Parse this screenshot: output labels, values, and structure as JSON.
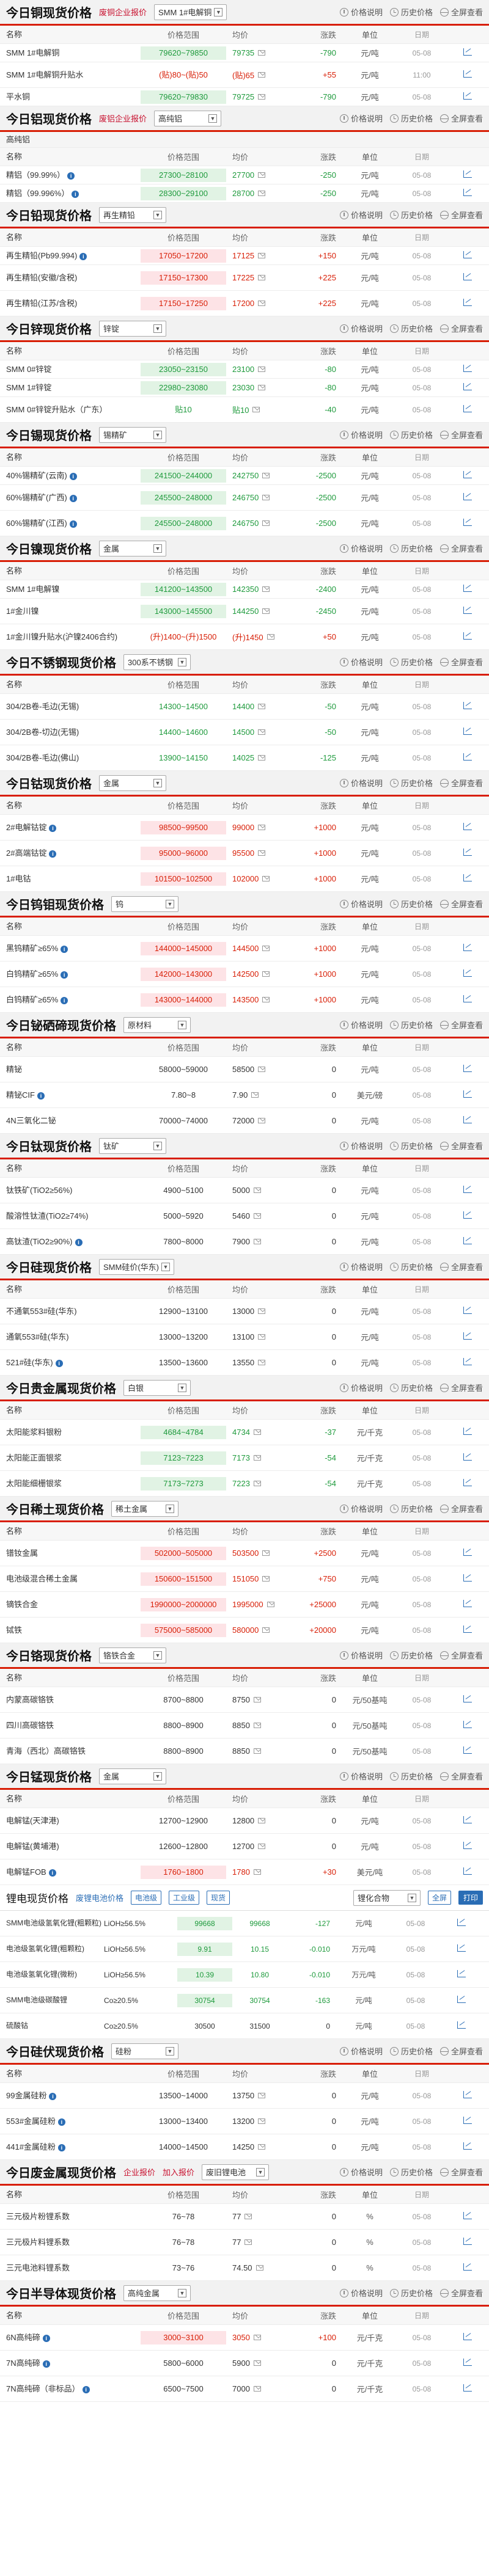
{
  "actions": {
    "desc": "价格说明",
    "hist": "历史价格",
    "all": "全屏查看"
  },
  "labels": {
    "corp_price": "废铝企业报价",
    "corp_price2": "企业报价",
    "add_alert": "加入报价"
  },
  "header": {
    "name": "名称",
    "range": "价格范围",
    "avg": "均价",
    "chg": "涨跌",
    "unit": "单位",
    "date": "日期"
  },
  "sections": [
    {
      "title": "今日铜现货价格",
      "link": "废铜企业报价",
      "sel": "SMM 1#电解铜",
      "rows": [
        {
          "name": "SMM 1#电解铜",
          "range": "79620~79850",
          "avg": "79735",
          "chg": "-790",
          "unit": "元/吨",
          "date": "05-08",
          "dir": "dn",
          "bg": "green"
        },
        {
          "name": "SMM 1#电解铜升贴水",
          "range": "(贴)80~(贴)50",
          "avg": "(贴)65",
          "chg": "+55",
          "unit": "元/吨",
          "date": "11:00",
          "dir": "up",
          "tall": true
        },
        {
          "name": "平水铜",
          "range": "79620~79830",
          "avg": "79725",
          "chg": "-790",
          "unit": "元/吨",
          "date": "05-08",
          "dir": "dn",
          "bg": "green"
        }
      ]
    },
    {
      "title": "今日铝现货价格",
      "link": "废铝企业报价",
      "sel": "高纯铝",
      "sub": "高纯铝",
      "rows": [
        {
          "name": "精铝（99.99%）",
          "range": "27300~28100",
          "avg": "27700",
          "chg": "-250",
          "unit": "元/吨",
          "date": "05-08",
          "dir": "dn",
          "bg": "green",
          "info": true
        },
        {
          "name": "精铝（99.996%）",
          "range": "28300~29100",
          "avg": "28700",
          "chg": "-250",
          "unit": "元/吨",
          "date": "05-08",
          "dir": "dn",
          "bg": "green",
          "info": true
        }
      ]
    },
    {
      "title": "今日铅现货价格",
      "link": "",
      "sel": "再生精铅",
      "rows": [
        {
          "name": "再生精铅(Pb99.994)",
          "range": "17050~17200",
          "avg": "17125",
          "chg": "+150",
          "unit": "元/吨",
          "date": "05-08",
          "dir": "up",
          "bg": "pink",
          "info": true
        },
        {
          "name": "再生精铅(安徽/含税)",
          "range": "17150~17300",
          "avg": "17225",
          "chg": "+225",
          "unit": "元/吨",
          "date": "05-08",
          "dir": "up",
          "bg": "pink",
          "tall": true
        },
        {
          "name": "再生精铅(江苏/含税)",
          "range": "17150~17250",
          "avg": "17200",
          "chg": "+225",
          "unit": "元/吨",
          "date": "05-08",
          "dir": "up",
          "bg": "pink",
          "tall": true
        }
      ]
    },
    {
      "title": "今日锌现货价格",
      "link": "",
      "sel": "锌锭",
      "rows": [
        {
          "name": "SMM 0#锌锭",
          "range": "23050~23150",
          "avg": "23100",
          "chg": "-80",
          "unit": "元/吨",
          "date": "05-08",
          "dir": "dn",
          "bg": "green"
        },
        {
          "name": "SMM 1#锌锭",
          "range": "22980~23080",
          "avg": "23030",
          "chg": "-80",
          "unit": "元/吨",
          "date": "05-08",
          "dir": "dn",
          "bg": "green"
        },
        {
          "name": "SMM 0#锌锭升贴水（广东）",
          "range": "贴10",
          "avg": "贴10",
          "chg": "-40",
          "unit": "元/吨",
          "date": "05-08",
          "dir": "dn",
          "tall": true
        }
      ]
    },
    {
      "title": "今日锡现货价格",
      "link": "",
      "sel": "锡精矿",
      "rows": [
        {
          "name": "40%锡精矿(云南)",
          "range": "241500~244000",
          "avg": "242750",
          "chg": "-2500",
          "unit": "元/吨",
          "date": "05-08",
          "dir": "dn",
          "bg": "green",
          "info": true
        },
        {
          "name": "60%锡精矿(广西)",
          "range": "245500~248000",
          "avg": "246750",
          "chg": "-2500",
          "unit": "元/吨",
          "date": "05-08",
          "dir": "dn",
          "bg": "green",
          "info": true,
          "tall": true
        },
        {
          "name": "60%锡精矿(江西)",
          "range": "245500~248000",
          "avg": "246750",
          "chg": "-2500",
          "unit": "元/吨",
          "date": "05-08",
          "dir": "dn",
          "bg": "green",
          "info": true,
          "tall": true
        }
      ]
    },
    {
      "title": "今日镍现货价格",
      "link": "",
      "sel": "金属",
      "rows": [
        {
          "name": "SMM 1#电解镍",
          "range": "141200~143500",
          "avg": "142350",
          "chg": "-2400",
          "unit": "元/吨",
          "date": "05-08",
          "dir": "dn",
          "bg": "green"
        },
        {
          "name": "1#金川镍",
          "range": "143000~145500",
          "avg": "144250",
          "chg": "-2450",
          "unit": "元/吨",
          "date": "05-08",
          "dir": "dn",
          "bg": "green",
          "tall": true
        },
        {
          "name": "1#金川镍升贴水(沪镍2406合约)",
          "range": "(升)1400~(升)1500",
          "avg": "(升)1450",
          "chg": "+50",
          "unit": "元/吨",
          "date": "05-08",
          "dir": "up",
          "tall": true
        }
      ]
    },
    {
      "title": "今日不锈钢现货价格",
      "link": "",
      "sel": "300系不锈钢",
      "rows": [
        {
          "name": "304/2B卷-毛边(无锡)",
          "range": "14300~14500",
          "avg": "14400",
          "chg": "-50",
          "unit": "元/吨",
          "date": "05-08",
          "dir": "dn",
          "tall": true
        },
        {
          "name": "304/2B卷-切边(无锡)",
          "range": "14400~14600",
          "avg": "14500",
          "chg": "-50",
          "unit": "元/吨",
          "date": "05-08",
          "dir": "dn",
          "tall": true
        },
        {
          "name": "304/2B卷-毛边(佛山)",
          "range": "13900~14150",
          "avg": "14025",
          "chg": "-125",
          "unit": "元/吨",
          "date": "05-08",
          "dir": "dn",
          "tall": true
        }
      ]
    },
    {
      "title": "今日钴现货价格",
      "link": "",
      "sel": "金属",
      "rows": [
        {
          "name": "2#电解钴锭",
          "range": "98500~99500",
          "avg": "99000",
          "chg": "+1000",
          "unit": "元/吨",
          "date": "05-08",
          "dir": "up",
          "bg": "pink",
          "info": true,
          "tall": true
        },
        {
          "name": "2#高端钴锭",
          "range": "95000~96000",
          "avg": "95500",
          "chg": "+1000",
          "unit": "元/吨",
          "date": "05-08",
          "dir": "up",
          "bg": "pink",
          "info": true,
          "tall": true
        },
        {
          "name": "1#电钴",
          "range": "101500~102500",
          "avg": "102000",
          "chg": "+1000",
          "unit": "元/吨",
          "date": "05-08",
          "dir": "up",
          "bg": "pink",
          "tall": true
        }
      ]
    },
    {
      "title": "今日钨钼现货价格",
      "link": "",
      "sel": "钨",
      "rows": [
        {
          "name": "黑钨精矿≥65%",
          "range": "144000~145000",
          "avg": "144500",
          "chg": "+1000",
          "unit": "元/吨",
          "date": "05-08",
          "dir": "up",
          "bg": "pink",
          "info": true,
          "tall": true
        },
        {
          "name": "白钨精矿≥65%",
          "range": "142000~143000",
          "avg": "142500",
          "chg": "+1000",
          "unit": "元/吨",
          "date": "05-08",
          "dir": "up",
          "bg": "pink",
          "info": true,
          "tall": true
        },
        {
          "name": "白钨精矿≥65%",
          "range": "143000~144000",
          "avg": "143500",
          "chg": "+1000",
          "unit": "元/吨",
          "date": "05-08",
          "dir": "up",
          "bg": "pink",
          "info": true,
          "tall": true
        }
      ]
    },
    {
      "title": "今日铋硒碲现货价格",
      "link": "",
      "sel": "原材料",
      "rows": [
        {
          "name": "精铋",
          "range": "58000~59000",
          "avg": "58500",
          "chg": "0",
          "unit": "元/吨",
          "date": "05-08",
          "dir": "",
          "tall": true
        },
        {
          "name": "精铋CIF",
          "range": "7.80~8",
          "avg": "7.90",
          "chg": "0",
          "unit": "美元/磅",
          "date": "05-08",
          "dir": "",
          "info": true,
          "tall": true
        },
        {
          "name": "4N三氧化二铋",
          "range": "70000~74000",
          "avg": "72000",
          "chg": "0",
          "unit": "元/吨",
          "date": "05-08",
          "dir": "",
          "tall": true
        }
      ]
    },
    {
      "title": "今日钛现货价格",
      "link": "",
      "sel": "钛矿",
      "rows": [
        {
          "name": "钛铁矿(TiO2≥56%)",
          "range": "4900~5100",
          "avg": "5000",
          "chg": "0",
          "unit": "元/吨",
          "date": "05-08",
          "dir": "",
          "tall": true
        },
        {
          "name": "酸溶性钛渣(TiO2≥74%)",
          "range": "5000~5920",
          "avg": "5460",
          "chg": "0",
          "unit": "元/吨",
          "date": "05-08",
          "dir": "",
          "tall": true
        },
        {
          "name": "高钛渣(TiO2≥90%)",
          "range": "7800~8000",
          "avg": "7900",
          "chg": "0",
          "unit": "元/吨",
          "date": "05-08",
          "dir": "",
          "info": true,
          "tall": true
        }
      ]
    },
    {
      "title": "今日硅现货价格",
      "link": "",
      "sel": "SMM硅价(华东)",
      "rows": [
        {
          "name": "不通氧553#硅(华东)",
          "range": "12900~13100",
          "avg": "13000",
          "chg": "0",
          "unit": "元/吨",
          "date": "05-08",
          "dir": "",
          "tall": true
        },
        {
          "name": "通氧553#硅(华东)",
          "range": "13000~13200",
          "avg": "13100",
          "chg": "0",
          "unit": "元/吨",
          "date": "05-08",
          "dir": "",
          "tall": true
        },
        {
          "name": "521#硅(华东)",
          "range": "13500~13600",
          "avg": "13550",
          "chg": "0",
          "unit": "元/吨",
          "date": "05-08",
          "dir": "",
          "info": true,
          "tall": true
        }
      ]
    },
    {
      "title": "今日贵金属现货价格",
      "link": "",
      "sel": "白银",
      "rows": [
        {
          "name": "太阳能浆料银粉",
          "range": "4684~4784",
          "avg": "4734",
          "chg": "-37",
          "unit": "元/千克",
          "date": "05-08",
          "dir": "dn",
          "bg": "green",
          "tall": true
        },
        {
          "name": "太阳能正面银浆",
          "range": "7123~7223",
          "avg": "7173",
          "chg": "-54",
          "unit": "元/千克",
          "date": "05-08",
          "dir": "dn",
          "bg": "green",
          "tall": true
        },
        {
          "name": "太阳能细栅银浆",
          "range": "7173~7273",
          "avg": "7223",
          "chg": "-54",
          "unit": "元/千克",
          "date": "05-08",
          "dir": "dn",
          "bg": "green",
          "tall": true
        }
      ]
    },
    {
      "title": "今日稀土现货价格",
      "link": "",
      "sel": "稀土金属",
      "rows": [
        {
          "name": "镨钕金属",
          "range": "502000~505000",
          "avg": "503500",
          "chg": "+2500",
          "unit": "元/吨",
          "date": "05-08",
          "dir": "up",
          "bg": "pink",
          "tall": true
        },
        {
          "name": "电池级混合稀土金属",
          "range": "150600~151500",
          "avg": "151050",
          "chg": "+750",
          "unit": "元/吨",
          "date": "05-08",
          "dir": "up",
          "bg": "pink",
          "tall": true
        },
        {
          "name": "镝铁合金",
          "range": "1990000~2000000",
          "avg": "1995000",
          "chg": "+25000",
          "unit": "元/吨",
          "date": "05-08",
          "dir": "up",
          "bg": "pink",
          "tall": true
        },
        {
          "name": "铽铁",
          "range": "575000~585000",
          "avg": "580000",
          "chg": "+20000",
          "unit": "元/吨",
          "date": "05-08",
          "dir": "up",
          "bg": "pink",
          "tall": true
        }
      ]
    },
    {
      "title": "今日铬现货价格",
      "link": "",
      "sel": "铬铁合金",
      "rows": [
        {
          "name": "内蒙高碳铬铁",
          "range": "8700~8800",
          "avg": "8750",
          "chg": "0",
          "unit": "元/50基吨",
          "date": "05-08",
          "dir": "",
          "tall": true
        },
        {
          "name": "四川高碳铬铁",
          "range": "8800~8900",
          "avg": "8850",
          "chg": "0",
          "unit": "元/50基吨",
          "date": "05-08",
          "dir": "",
          "tall": true
        },
        {
          "name": "青海（西北）高碳铬铁",
          "range": "8800~8900",
          "avg": "8850",
          "chg": "0",
          "unit": "元/50基吨",
          "date": "05-08",
          "dir": "",
          "tall": true
        }
      ]
    },
    {
      "title": "今日锰现货价格",
      "link": "",
      "sel": "金属",
      "rows": [
        {
          "name": "电解锰(天津港)",
          "range": "12700~12900",
          "avg": "12800",
          "chg": "0",
          "unit": "元/吨",
          "date": "05-08",
          "dir": "",
          "tall": true
        },
        {
          "name": "电解锰(黄埔港)",
          "range": "12600~12800",
          "avg": "12700",
          "chg": "0",
          "unit": "元/吨",
          "date": "05-08",
          "dir": "",
          "tall": true
        },
        {
          "name": "电解锰FOB",
          "range": "1760~1800",
          "avg": "1780",
          "chg": "+30",
          "unit": "美元/吨",
          "date": "05-08",
          "dir": "up",
          "bg": "pink",
          "info": true,
          "tall": true
        }
      ]
    }
  ],
  "lithium": {
    "title": "锂电现货价格",
    "link": "废锂电池价格",
    "tabs": [
      "电池级",
      "工业级",
      "现货"
    ],
    "sel": "锂化合物",
    "btn_all": "全屏",
    "btn_print": "打印",
    "rows": [
      {
        "name": "SMM电池级氢氧化锂(粗颗粒)",
        "spec": "LiOH≥56.5%",
        "range": "99668",
        "avg": "99668",
        "chg": "-127",
        "unit": "元/吨",
        "date": "05-08",
        "dir": "dn",
        "bg": "green"
      },
      {
        "name": "电池级氢氧化锂(粗颗粒)",
        "spec": "LiOH≥56.5%",
        "range": "9.91",
        "avg": "10.15",
        "chg": "-0.010",
        "unit": "万元/吨",
        "date": "05-08",
        "dir": "dn",
        "bg": "green"
      },
      {
        "name": "电池级氢氧化锂(微粉)",
        "spec": "LiOH≥56.5%",
        "range": "10.39",
        "avg": "10.80",
        "chg": "-0.010",
        "unit": "万元/吨",
        "date": "05-08",
        "dir": "dn",
        "bg": "green"
      },
      {
        "name": "SMM电池级碳酸锂",
        "spec": "Co≥20.5%",
        "range": "30754",
        "avg": "30754",
        "chg": "-163",
        "unit": "元/吨",
        "date": "05-08",
        "dir": "dn",
        "bg": "green"
      },
      {
        "name": "硫酸钴",
        "spec": "Co≥20.5%",
        "range": "30500",
        "avg": "31500",
        "chg": "0",
        "unit": "元/吨",
        "date": "05-08",
        "dir": ""
      }
    ]
  },
  "sections2": [
    {
      "title": "今日硅伏现货价格",
      "link": "",
      "sel": "硅粉",
      "rows": [
        {
          "name": "99金属硅粉",
          "range": "13500~14000",
          "avg": "13750",
          "chg": "0",
          "unit": "元/吨",
          "date": "05-08",
          "dir": "",
          "info": true,
          "tall": true
        },
        {
          "name": "553#金属硅粉",
          "range": "13000~13400",
          "avg": "13200",
          "chg": "0",
          "unit": "元/吨",
          "date": "05-08",
          "dir": "",
          "info": true,
          "tall": true
        },
        {
          "name": "441#金属硅粉",
          "range": "14000~14500",
          "avg": "14250",
          "chg": "0",
          "unit": "元/吨",
          "date": "05-08",
          "dir": "",
          "info": true,
          "tall": true
        }
      ]
    },
    {
      "title": "今日废金属现货价格",
      "link": "企业报价",
      "link2": "加入报价",
      "sel": "废旧锂电池",
      "rows": [
        {
          "name": "三元极片粉锂系数",
          "range": "76~78",
          "avg": "77",
          "chg": "0",
          "unit": "%",
          "date": "05-08",
          "dir": "",
          "tall": true
        },
        {
          "name": "三元极片料锂系数",
          "range": "76~78",
          "avg": "77",
          "chg": "0",
          "unit": "%",
          "date": "05-08",
          "dir": "",
          "tall": true
        },
        {
          "name": "三元电池料锂系数",
          "range": "73~76",
          "avg": "74.50",
          "chg": "0",
          "unit": "%",
          "date": "05-08",
          "dir": "",
          "tall": true
        }
      ]
    },
    {
      "title": "今日半导体现货价格",
      "link": "",
      "sel": "高纯金属",
      "rows": [
        {
          "name": "6N高纯碲",
          "range": "3000~3100",
          "avg": "3050",
          "chg": "+100",
          "unit": "元/千克",
          "date": "05-08",
          "dir": "up",
          "bg": "pink",
          "info": true,
          "tall": true
        },
        {
          "name": "7N高纯碲",
          "range": "5800~6000",
          "avg": "5900",
          "chg": "0",
          "unit": "元/千克",
          "date": "05-08",
          "dir": "",
          "info": true,
          "tall": true
        },
        {
          "name": "7N高纯碲（非标品）",
          "range": "6500~7500",
          "avg": "7000",
          "chg": "0",
          "unit": "元/千克",
          "date": "05-08",
          "dir": "",
          "info": true,
          "tall": true
        }
      ]
    }
  ],
  "colors": {
    "up": "#d81e06",
    "down": "#1e9a3c",
    "accent": "#2a6db5"
  }
}
